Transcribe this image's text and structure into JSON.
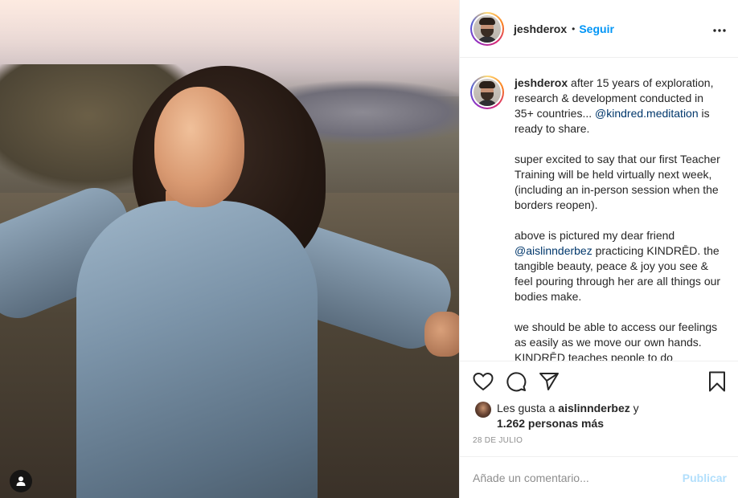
{
  "post": {
    "author": "jeshderox",
    "separator": "•",
    "follow_label": "Seguir",
    "more_label": "•••",
    "caption": {
      "author": "jeshderox",
      "p1_a": " after 15 years of exploration, research & development conducted in 35+ countries... ",
      "p1_mention": "@kindred.meditation",
      "p1_b": " is ready to share.",
      "p2": "super excited to say that our first Teacher Training will be held virtually next week, (including an in-person session when the borders reopen).",
      "p3_a": "above is pictured my dear friend ",
      "p3_mention": "@aislinnderbez",
      "p3_b": " practicing KINDRĒD. the tangible beauty, peace & joy you see & feel pouring through her are all things our bodies make.",
      "p4": "we should be able to access our feelings as easily as we move our own hands. KINDRĒD teaches people to do"
    },
    "likes": {
      "prefix": "Les gusta a ",
      "user": "aislinnderbez",
      "conj": " y",
      "others": "1.262 personas más"
    },
    "date": "28 DE JULIO",
    "comment": {
      "placeholder": "Añade un comentario...",
      "publish_label": "Publicar"
    }
  },
  "icons": {
    "like": "heart-icon",
    "comment": "comment-icon",
    "share": "paper-plane-icon",
    "save": "bookmark-icon",
    "tagged": "user-tag-icon"
  },
  "colors": {
    "link": "#0095f6",
    "mention": "#00376b",
    "muted": "#8e8e8e",
    "publish_disabled": "#b2dffc"
  }
}
